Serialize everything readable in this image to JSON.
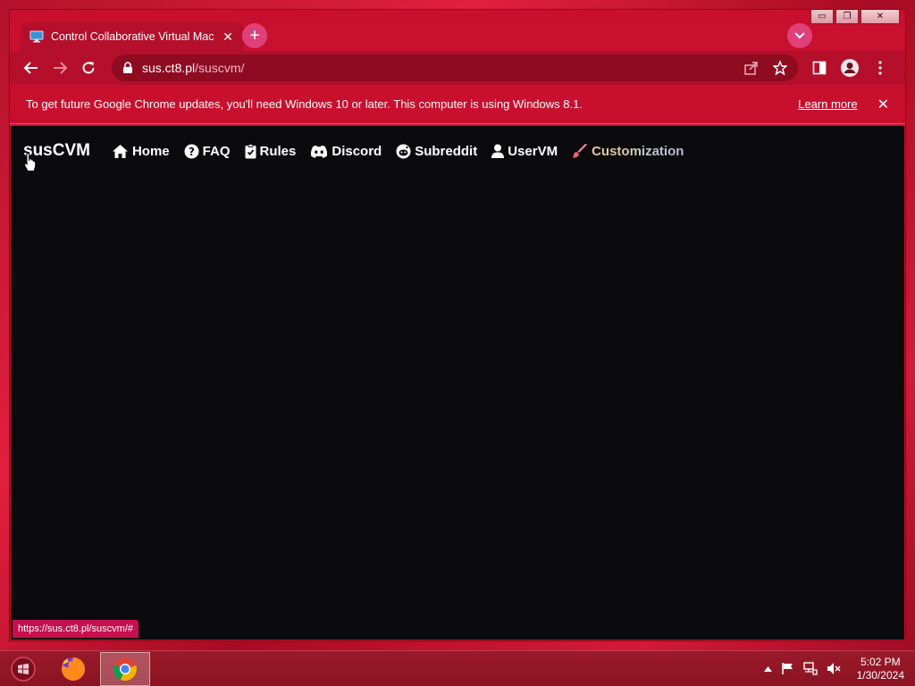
{
  "browser": {
    "tab": {
      "title": "Control Collaborative Virtual Mac",
      "close_icon": "close-icon",
      "favicon": "monitor-icon"
    },
    "toolbar": {
      "url_host": "sus.ct8.pl",
      "url_path": "/suscvm/"
    },
    "infobar": {
      "message": "To get future Google Chrome updates, you'll need Windows 10 or later. This computer is using Windows 8.1.",
      "learn_more": "Learn more"
    },
    "status_url": "https://sus.ct8.pl/suscvm/#",
    "window_controls": {
      "minimize": "▭",
      "restore": "❐",
      "close": "✕"
    }
  },
  "site": {
    "brand": "susCVM",
    "nav": [
      {
        "label": "Home",
        "icon": "home-icon"
      },
      {
        "label": "FAQ",
        "icon": "question-icon"
      },
      {
        "label": "Rules",
        "icon": "clipboard-icon"
      },
      {
        "label": "Discord",
        "icon": "discord-icon"
      },
      {
        "label": "Subreddit",
        "icon": "reddit-icon"
      },
      {
        "label": "UserVM",
        "icon": "user-icon"
      },
      {
        "label": "Customization",
        "icon": "brush-icon"
      }
    ]
  },
  "taskbar": {
    "apps": [
      "firefox",
      "chrome"
    ],
    "clock": {
      "time": "5:02 PM",
      "date": "1/30/2024"
    }
  },
  "colors": {
    "accent": "#c8102e",
    "page_bg": "#0b0a0c",
    "status_bg": "#c8104e"
  }
}
